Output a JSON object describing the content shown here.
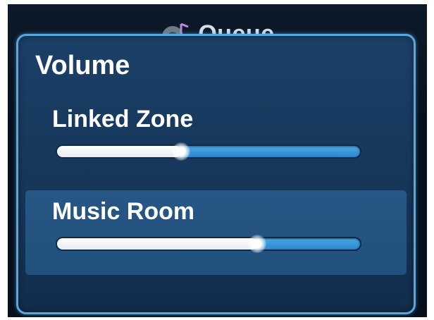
{
  "header": {
    "title": "Queue",
    "icon": "music-note-icon"
  },
  "volume_panel": {
    "title": "Volume",
    "zones": [
      {
        "name": "Linked Zone",
        "volume_fraction": 0.41,
        "selected": false
      },
      {
        "name": "Music Room",
        "volume_fraction": 0.66,
        "selected": true
      }
    ]
  },
  "colors": {
    "panel_border": "#5aa7e0",
    "panel_bg": "#1b4067",
    "selected_bg": "#285785",
    "slider_track": "#2b86cf",
    "slider_fill": "#ffffff"
  }
}
